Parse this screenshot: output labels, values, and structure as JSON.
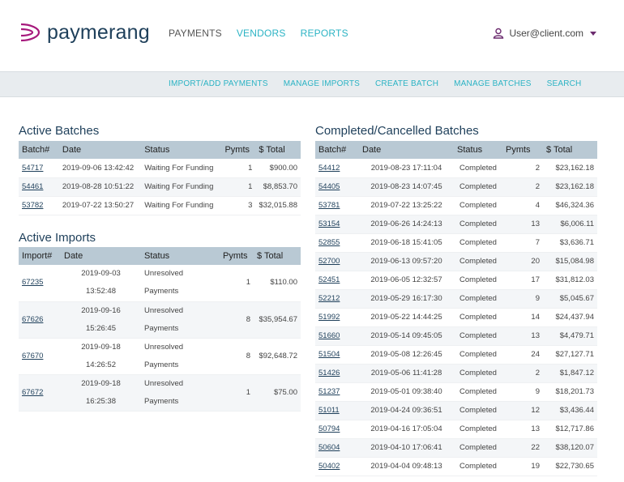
{
  "brand": {
    "name": "paymerang",
    "colors": {
      "brand_purple": "#a6197c",
      "navy": "#1e3f5a",
      "teal": "#2bb3c4",
      "header_row": "#b9c9d4"
    }
  },
  "top_nav": {
    "items": [
      "PAYMENTS",
      "VENDORS",
      "REPORTS"
    ],
    "active": "PAYMENTS"
  },
  "user": {
    "label": "User@client.com",
    "icon": "user-icon"
  },
  "sub_nav": {
    "items": [
      "IMPORT/ADD PAYMENTS",
      "MANAGE IMPORTS",
      "CREATE BATCH",
      "MANAGE BATCHES",
      "SEARCH"
    ]
  },
  "active_batches": {
    "title": "Active Batches",
    "columns": [
      "Batch#",
      "Date",
      "Status",
      "Pymts",
      "$ Total"
    ],
    "rows": [
      [
        "54717",
        "2019-09-06 13:42:42",
        "Waiting For Funding",
        "1",
        "$900.00"
      ],
      [
        "54461",
        "2019-08-28 10:51:22",
        "Waiting For Funding",
        "1",
        "$8,853.70"
      ],
      [
        "53782",
        "2019-07-22 13:50:27",
        "Waiting For Funding",
        "3",
        "$32,015.88"
      ]
    ]
  },
  "active_imports": {
    "title": "Active Imports",
    "columns": [
      "Import#",
      "Date",
      "Status",
      "Pymts",
      "$ Total"
    ],
    "rows": [
      [
        "67235",
        "2019-09-03",
        "13:52:48",
        "Unresolved",
        "Payments",
        "1",
        "$110.00"
      ],
      [
        "67626",
        "2019-09-16",
        "15:26:45",
        "Unresolved",
        "Payments",
        "8",
        "$35,954.67"
      ],
      [
        "67670",
        "2019-09-18",
        "14:26:52",
        "Unresolved",
        "Payments",
        "8",
        "$92,648.72"
      ],
      [
        "67672",
        "2019-09-18",
        "16:25:38",
        "Unresolved",
        "Payments",
        "1",
        "$75.00"
      ]
    ]
  },
  "completed_batches": {
    "title": "Completed/Cancelled Batches",
    "columns": [
      "Batch#",
      "Date",
      "Status",
      "Pymts",
      "$ Total"
    ],
    "rows": [
      [
        "54412",
        "2019-08-23 17:11:04",
        "Completed",
        "2",
        "$23,162.18"
      ],
      [
        "54405",
        "2019-08-23 14:07:45",
        "Completed",
        "2",
        "$23,162.18"
      ],
      [
        "53781",
        "2019-07-22 13:25:22",
        "Completed",
        "4",
        "$46,324.36"
      ],
      [
        "53154",
        "2019-06-26 14:24:13",
        "Completed",
        "13",
        "$6,006.11"
      ],
      [
        "52855",
        "2019-06-18 15:41:05",
        "Completed",
        "7",
        "$3,636.71"
      ],
      [
        "52700",
        "2019-06-13 09:57:20",
        "Completed",
        "20",
        "$15,084.98"
      ],
      [
        "52451",
        "2019-06-05 12:32:57",
        "Completed",
        "17",
        "$31,812.03"
      ],
      [
        "52212",
        "2019-05-29 16:17:30",
        "Completed",
        "9",
        "$5,045.67"
      ],
      [
        "51992",
        "2019-05-22 14:44:25",
        "Completed",
        "14",
        "$24,437.94"
      ],
      [
        "51660",
        "2019-05-14 09:45:05",
        "Completed",
        "13",
        "$4,479.71"
      ],
      [
        "51504",
        "2019-05-08 12:26:45",
        "Completed",
        "24",
        "$27,127.71"
      ],
      [
        "51426",
        "2019-05-06 11:41:28",
        "Completed",
        "2",
        "$1,847.12"
      ],
      [
        "51237",
        "2019-05-01 09:38:40",
        "Completed",
        "9",
        "$18,201.73"
      ],
      [
        "51011",
        "2019-04-24 09:36:51",
        "Completed",
        "12",
        "$3,436.44"
      ],
      [
        "50794",
        "2019-04-16 17:05:04",
        "Completed",
        "13",
        "$12,717.86"
      ],
      [
        "50604",
        "2019-04-10 17:06:41",
        "Completed",
        "22",
        "$38,120.07"
      ],
      [
        "50402",
        "2019-04-04 09:48:13",
        "Completed",
        "19",
        "$22,730.65"
      ]
    ]
  }
}
